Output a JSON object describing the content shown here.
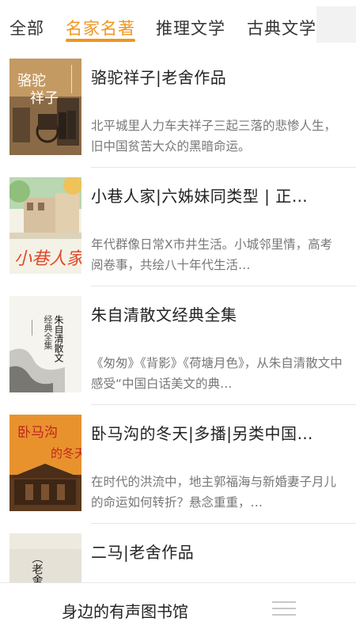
{
  "tabs": [
    {
      "label": "全部",
      "active": false
    },
    {
      "label": "名家名著",
      "active": true
    },
    {
      "label": "推理文学",
      "active": false
    },
    {
      "label": "古典文学",
      "active": false
    }
  ],
  "books": [
    {
      "title": "骆驼祥子|老舍作品",
      "description": "北平城里人力车夫祥子三起三落的悲惨人生，旧中国贫苦大众的黑暗命运。",
      "cover_text": "骆驼祥子"
    },
    {
      "title": "小巷人家|六姊妹同类型 | 正…",
      "description": "年代群像日常X市井生活。小城邻里情，高考阅卷事，共绘八十年代生活…",
      "cover_text": "小巷人家"
    },
    {
      "title": "朱自清散文经典全集",
      "description": "《匆匆》《背影》《荷塘月色》，从朱自清散文中感受“中国白话美文的典…",
      "cover_text": "朱自清散文",
      "cover_subtext": "经典全集"
    },
    {
      "title": "卧马沟的冬天|多播|另类中国…",
      "description": "在时代的洪流中，地主郭福海与新婚妻子月儿的命运如何转折？悬念重重，…",
      "cover_text": "卧马沟的冬天"
    },
    {
      "title": "二马|老舍作品",
      "description": "",
      "cover_text": "老舍作"
    }
  ],
  "bottom_bar": {
    "title": "身边的有声图书馆",
    "menu_icon": "list-menu-icon"
  },
  "colors": {
    "accent": "#f0961e",
    "text": "#222222",
    "muted": "#777777"
  }
}
